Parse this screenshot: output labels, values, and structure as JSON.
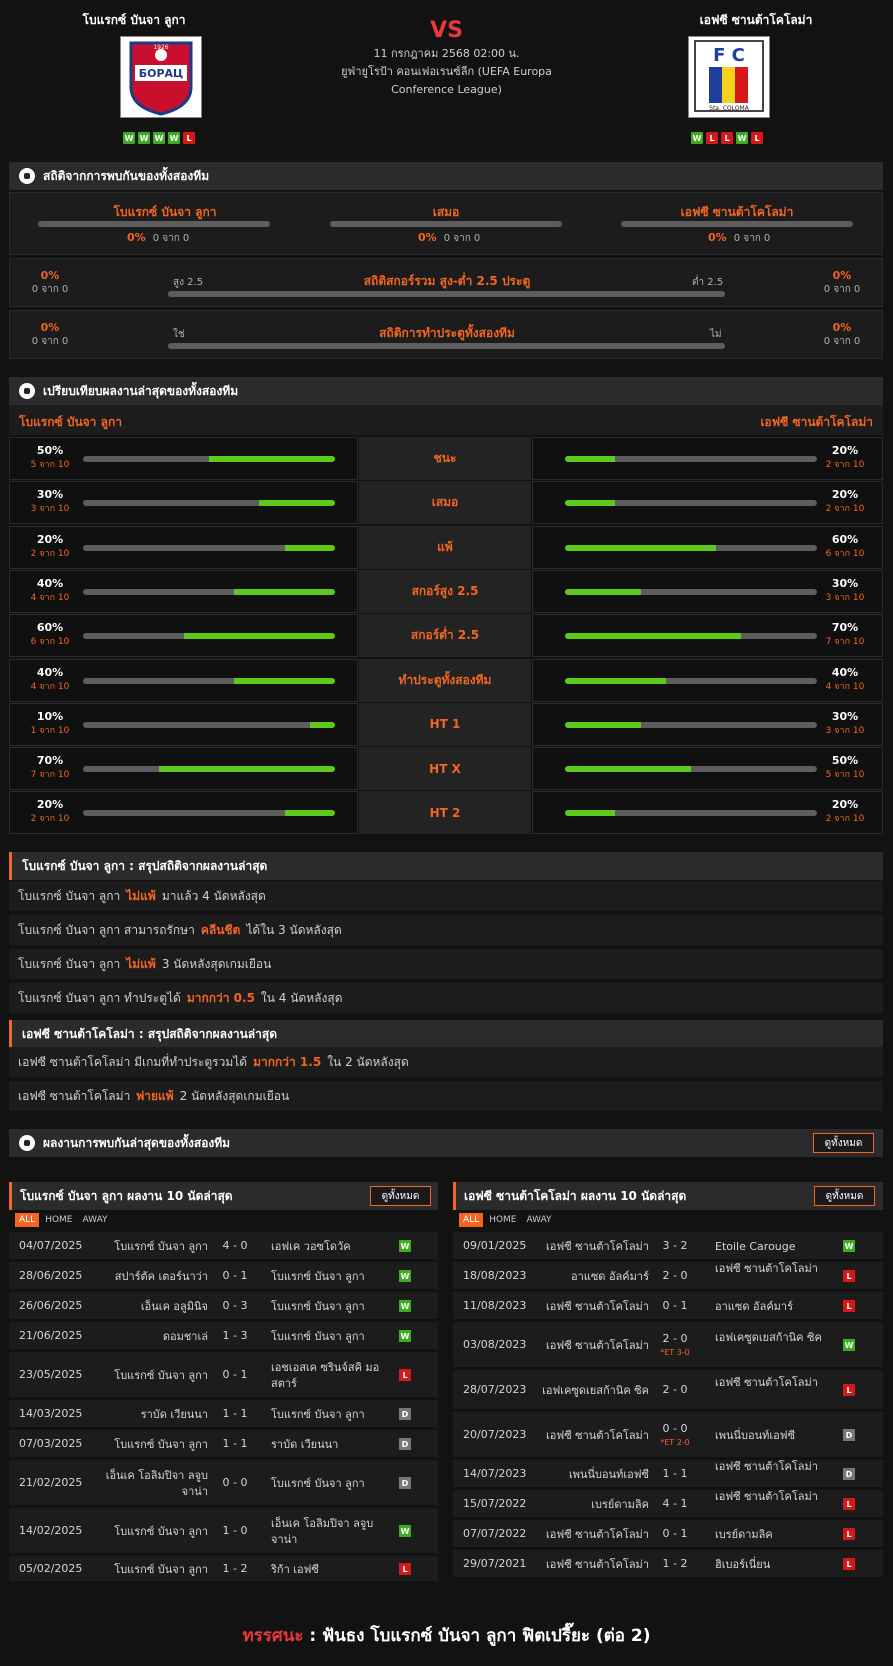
{
  "header": {
    "home_name": "โบแรกซ์ บันจา ลูกา",
    "away_name": "เอฟซี ซานต้าโคโลม่า",
    "vs": "VS",
    "datetime": "11 กรกฎาคม 2568 02:00 น.",
    "competition": "ยูฟ่ายูโรป้า คอนเฟอเรนซ์ลีก (UEFA Europa Conference League)",
    "home_form": [
      "W",
      "W",
      "W",
      "W",
      "L"
    ],
    "away_form": [
      "W",
      "L",
      "L",
      "W",
      "L"
    ],
    "home_logo_text": "БОРАЦ",
    "home_logo_sub": "1926",
    "away_logo_text": "F C",
    "away_logo_sub": "Sta. COLOMA"
  },
  "h2h": {
    "title": "สถิติจากการพบกันของทั้งสองทีม",
    "home": {
      "label": "โบแรกซ์ บันจา ลูกา",
      "pct": "0%",
      "of": "0 จาก 0"
    },
    "draw": {
      "label": "เสมอ",
      "pct": "0%",
      "of": "0 จาก 0"
    },
    "away": {
      "label": "เอฟซี ซานต้าโคโลม่า",
      "pct": "0%",
      "of": "0 จาก 0"
    },
    "ou": {
      "title": "สถิติสกอร์รวม สูง-ต่ำ 2.5 ประตู",
      "left_label": "สูง 2.5",
      "right_label": "ต่ำ 2.5",
      "left_pct": "0%",
      "left_of": "0 จาก 0",
      "right_pct": "0%",
      "right_of": "0 จาก 0"
    },
    "btts": {
      "title": "สถิติการทำประตูทั้งสองทีม",
      "left_label": "ใช่",
      "right_label": "ไม่",
      "left_pct": "0%",
      "left_of": "0 จาก 0",
      "right_pct": "0%",
      "right_of": "0 จาก 0"
    }
  },
  "compare": {
    "title": "เปรียบเทียบผลงานล่าสุดของทั้งสองทีม",
    "home_label": "โบแรกซ์ บันจา ลูกา",
    "away_label": "เอฟซี ซานต้าโคโลม่า",
    "rows": [
      {
        "label": "ชนะ",
        "home_pct": "50%",
        "home_of": "5 จาก 10",
        "home_val": 0.5,
        "away_pct": "20%",
        "away_of": "2 จาก 10",
        "away_val": 0.2
      },
      {
        "label": "เสมอ",
        "home_pct": "30%",
        "home_of": "3 จาก 10",
        "home_val": 0.3,
        "away_pct": "20%",
        "away_of": "2 จาก 10",
        "away_val": 0.2
      },
      {
        "label": "แพ้",
        "home_pct": "20%",
        "home_of": "2 จาก 10",
        "home_val": 0.2,
        "away_pct": "60%",
        "away_of": "6 จาก 10",
        "away_val": 0.6
      },
      {
        "label": "สกอร์สูง 2.5",
        "home_pct": "40%",
        "home_of": "4 จาก 10",
        "home_val": 0.4,
        "away_pct": "30%",
        "away_of": "3 จาก 10",
        "away_val": 0.3
      },
      {
        "label": "สกอร์ต่ำ 2.5",
        "home_pct": "60%",
        "home_of": "6 จาก 10",
        "home_val": 0.6,
        "away_pct": "70%",
        "away_of": "7 จาก 10",
        "away_val": 0.7
      },
      {
        "label": "ทำประตูทั้งสองทีม",
        "home_pct": "40%",
        "home_of": "4 จาก 10",
        "home_val": 0.4,
        "away_pct": "40%",
        "away_of": "4 จาก 10",
        "away_val": 0.4
      },
      {
        "label": "HT 1",
        "home_pct": "10%",
        "home_of": "1 จาก 10",
        "home_val": 0.1,
        "away_pct": "30%",
        "away_of": "3 จาก 10",
        "away_val": 0.3
      },
      {
        "label": "HT X",
        "home_pct": "70%",
        "home_of": "7 จาก 10",
        "home_val": 0.7,
        "away_pct": "50%",
        "away_of": "5 จาก 10",
        "away_val": 0.5
      },
      {
        "label": "HT 2",
        "home_pct": "20%",
        "home_of": "2 จาก 10",
        "home_val": 0.2,
        "away_pct": "20%",
        "away_of": "2 จาก 10",
        "away_val": 0.2
      }
    ]
  },
  "home_summary": {
    "title": "โบแรกซ์ บันจา ลูกา : สรุปสถิติจากผลงานล่าสุด",
    "rows": [
      {
        "a": "โบแรกซ์ บันจา ลูกา",
        "b": "ไม่แพ้",
        "c": "มาแล้ว 4 นัดหลังสุด"
      },
      {
        "a": "โบแรกซ์ บันจา ลูกา  สามารถรักษา",
        "b": "คลีนชีต",
        "c": "ได้ใน 3 นัดหลังสุด"
      },
      {
        "a": "โบแรกซ์ บันจา ลูกา",
        "b": "ไม่แพ้",
        "c": "3  นัดหลังสุดเกมเยือน"
      },
      {
        "a": "โบแรกซ์ บันจา ลูกา  ทำประตูได้",
        "b": "มากกว่า  0.5",
        "c": "ใน 4 นัดหลังสุด"
      }
    ]
  },
  "away_summary": {
    "title": "เอฟซี ซานต้าโคโลม่า : สรุปสถิติจากผลงานล่าสุด",
    "rows": [
      {
        "a": "เอฟซี ซานต้าโคโลม่า  มีเกมที่ทำประตูรวมได้",
        "b": "มากกว่า  1.5",
        "c": "ใน 2 นัดหลังสุด"
      },
      {
        "a": "เอฟซี ซานต้าโคโลม่า",
        "b": "พ่ายแพ้",
        "c": "2  นัดหลังสุดเกมเยือน"
      }
    ]
  },
  "recent": {
    "title": "ผลงานการพบกันล่าสุดของทั้งสองทีม",
    "view_all": "ดูทั้งหมด"
  },
  "last_home": {
    "title": "โบแรกซ์ บันจา ลูกา ผลงาน 10 นัดล่าสุด",
    "view_all": "ดูทั้งหมด",
    "tabs": [
      "ALL",
      "HOME",
      "AWAY"
    ],
    "matches": [
      {
        "date": "04/07/2025",
        "home": "โบแรกซ์ บันจา ลูกา",
        "score": "4 - 0",
        "away": "เอฟเค วอซโดวัค",
        "res": "W"
      },
      {
        "date": "28/06/2025",
        "home": "สปาร์ตัค เตอร์นาว่า",
        "score": "0 - 1",
        "away": "โบแรกซ์ บันจา ลูกา",
        "res": "W"
      },
      {
        "date": "26/06/2025",
        "home": "เอ็นเค อลูมินิจ",
        "score": "0 - 3",
        "away": "โบแรกซ์ บันจา ลูกา",
        "res": "W"
      },
      {
        "date": "21/06/2025",
        "home": "ดอมชาเล่",
        "score": "1 - 3",
        "away": "โบแรกซ์ บันจา ลูกา",
        "res": "W"
      },
      {
        "date": "23/05/2025",
        "home": "โบแรกซ์ บันจา ลูกา",
        "score": "0 - 1",
        "away": "เอชเอสเค ซรินจ์สคิ มอสตาร์",
        "res": "L"
      },
      {
        "date": "14/03/2025",
        "home": "ราบัด เวียนนา",
        "score": "1 - 1",
        "away": "โบแรกซ์ บันจา ลูกา",
        "res": "D"
      },
      {
        "date": "07/03/2025",
        "home": "โบแรกซ์ บันจา ลูกา",
        "score": "1 - 1",
        "away": "ราบัด เวียนนา",
        "res": "D"
      },
      {
        "date": "21/02/2025",
        "home": "เอ็นเค โอลิมปิจา ลจูบ จาน่า",
        "score": "0 - 0",
        "away": "โบแรกซ์ บันจา ลูกา",
        "res": "D"
      },
      {
        "date": "14/02/2025",
        "home": "โบแรกซ์ บันจา ลูกา",
        "score": "1 - 0",
        "away": "เอ็นเค โอลิมปิจา ลจูบ จาน่า",
        "res": "W"
      },
      {
        "date": "05/02/2025",
        "home": "โบแรกซ์ บันจา ลูกา",
        "score": "1 - 2",
        "away": "ริก้า เอฟซี",
        "res": "L"
      }
    ]
  },
  "last_away": {
    "title": "เอฟซี ซานต้าโคโลม่า ผลงาน 10 นัดล่าสุด",
    "view_all": "ดูทั้งหมด",
    "tabs": [
      "ALL",
      "HOME",
      "AWAY"
    ],
    "matches": [
      {
        "date": "09/01/2025",
        "home": "เอฟซี ซานต้าโคโลม่า",
        "score": "3 - 2",
        "away": "Etoile Carouge",
        "res": "W",
        "et": ""
      },
      {
        "date": "18/08/2023",
        "home": "อาแซด อัลค์มาร์",
        "score": "2 - 0",
        "away": "เอฟซี ซานต้าโคโลม่า",
        "res": "L",
        "et": ""
      },
      {
        "date": "11/08/2023",
        "home": "เอฟซี ซานต้าโคโลม่า",
        "score": "0 - 1",
        "away": "อาแซด อัลค์มาร์",
        "res": "L",
        "et": ""
      },
      {
        "date": "03/08/2023",
        "home": "เอฟซี ซานต้าโคโลม่า",
        "score": "2 - 0",
        "away": "เอฟเคซูดเยสก้านิค ซิค",
        "res": "W",
        "et": "*ET 3-0"
      },
      {
        "date": "28/07/2023",
        "home": "เอฟเคซูดเยสก้านิค ซิค",
        "score": "2 - 0",
        "away": "เอฟซี ซานต้าโคโลม่า",
        "res": "L",
        "et": ""
      },
      {
        "date": "20/07/2023",
        "home": "เอฟซี ซานต้าโคโลม่า",
        "score": "0 - 0",
        "away": "เพนนี่บอนท์เอฟซี",
        "res": "D",
        "et": "*ET 2-0"
      },
      {
        "date": "14/07/2023",
        "home": "เพนนี่บอนท์เอฟซี",
        "score": "1 - 1",
        "away": "เอฟซี ซานต้าโคโลม่า",
        "res": "D",
        "et": ""
      },
      {
        "date": "15/07/2022",
        "home": "เบรย์ดามลิค",
        "score": "4 - 1",
        "away": "เอฟซี ซานต้าโคโลม่า",
        "res": "L",
        "et": ""
      },
      {
        "date": "07/07/2022",
        "home": "เอฟซี ซานต้าโคโลม่า",
        "score": "0 - 1",
        "away": "เบรย์ดามลิค",
        "res": "L",
        "et": ""
      },
      {
        "date": "29/07/2021",
        "home": "เอฟซี ซานต้าโคโลม่า",
        "score": "1 - 2",
        "away": "ฮิเบอร์เนี่ยน",
        "res": "L",
        "et": ""
      }
    ]
  },
  "prediction": {
    "label": "ทรรศนะ",
    "sep": ":",
    "text": "ฟันธง โบแรกซ์ บันจา ลูกา ฟิตเปรี๊ยะ (ต่อ 2)"
  },
  "colors": {
    "accent": "#f26522",
    "win": "#3dac1f",
    "loss": "#d51818",
    "draw": "#777777",
    "bar_fill": "#5fc81c",
    "vs": "#e8383d"
  }
}
